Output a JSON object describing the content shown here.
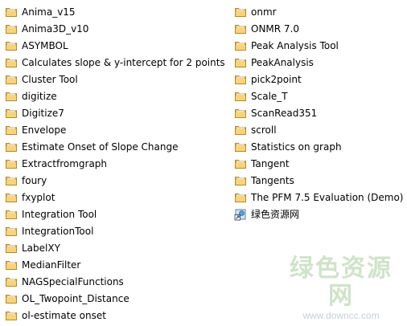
{
  "folders_left": [
    {
      "label": "Anima_v15",
      "icon": "folder-icon"
    },
    {
      "label": "Anima3D_v10",
      "icon": "folder-icon"
    },
    {
      "label": "ASYMBOL",
      "icon": "folder-icon"
    },
    {
      "label": "Calculates slope & y-intercept for 2 points",
      "icon": "folder-icon"
    },
    {
      "label": "Cluster Tool",
      "icon": "folder-icon"
    },
    {
      "label": "digitize",
      "icon": "folder-icon"
    },
    {
      "label": "Digitize7",
      "icon": "folder-icon"
    },
    {
      "label": "Envelope",
      "icon": "folder-icon"
    },
    {
      "label": "Estimate Onset of Slope Change",
      "icon": "folder-icon"
    },
    {
      "label": "Extractfromgraph",
      "icon": "folder-icon"
    },
    {
      "label": "foury",
      "icon": "folder-icon"
    },
    {
      "label": "fxyplot",
      "icon": "folder-icon"
    },
    {
      "label": "Integration Tool",
      "icon": "folder-icon"
    },
    {
      "label": "IntegrationTool",
      "icon": "folder-icon"
    },
    {
      "label": "LabelXY",
      "icon": "folder-icon"
    },
    {
      "label": "MedianFilter",
      "icon": "folder-icon"
    },
    {
      "label": "NAGSpecialFunctions",
      "icon": "folder-icon"
    },
    {
      "label": "OL_Twopoint_Distance",
      "icon": "folder-icon"
    },
    {
      "label": "ol-estimate onset",
      "icon": "folder-icon"
    }
  ],
  "folders_right": [
    {
      "label": "onmr",
      "icon": "folder-icon"
    },
    {
      "label": "ONMR 7.0",
      "icon": "folder-icon"
    },
    {
      "label": "Peak Analysis Tool",
      "icon": "folder-icon"
    },
    {
      "label": "PeakAnalysis",
      "icon": "folder-icon"
    },
    {
      "label": "pick2point",
      "icon": "folder-icon"
    },
    {
      "label": "Scale_T",
      "icon": "folder-icon"
    },
    {
      "label": "ScanRead351",
      "icon": "folder-icon"
    },
    {
      "label": "scroll",
      "icon": "folder-icon"
    },
    {
      "label": "Statistics on graph",
      "icon": "folder-icon"
    },
    {
      "label": "Tangent",
      "icon": "folder-icon"
    },
    {
      "label": "Tangents",
      "icon": "folder-icon"
    },
    {
      "label": "The PFM 7.5 Evaluation (Demo)",
      "icon": "folder-icon"
    }
  ],
  "shortcut_item": {
    "label": "绿色资源网",
    "icon": "internet-shortcut-icon"
  },
  "watermark": {
    "name": "绿色资源网",
    "url": "www.downcc.com"
  },
  "colors": {
    "folder_body": "#e8b94a",
    "folder_front": "#f6d57a",
    "folder_edge": "#b8872a",
    "watermark_green": "#cfe3c9"
  }
}
